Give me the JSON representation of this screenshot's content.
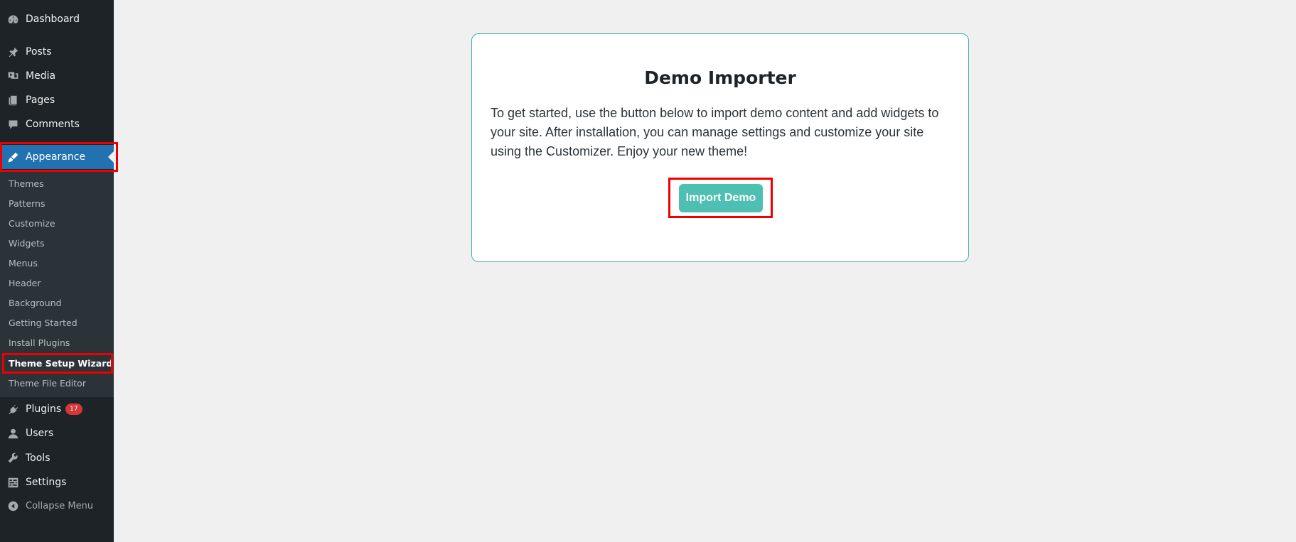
{
  "sidebar": {
    "items": [
      {
        "label": "Dashboard",
        "icon": "dashboard-icon"
      },
      {
        "label": "Posts",
        "icon": "pin-icon"
      },
      {
        "label": "Media",
        "icon": "media-icon"
      },
      {
        "label": "Pages",
        "icon": "pages-icon"
      },
      {
        "label": "Comments",
        "icon": "comment-icon"
      },
      {
        "label": "Appearance",
        "icon": "brush-icon"
      },
      {
        "label": "Plugins",
        "icon": "plugin-icon",
        "badge": "17"
      },
      {
        "label": "Users",
        "icon": "user-icon"
      },
      {
        "label": "Tools",
        "icon": "wrench-icon"
      },
      {
        "label": "Settings",
        "icon": "settings-icon"
      }
    ],
    "submenu": [
      "Themes",
      "Patterns",
      "Customize",
      "Widgets",
      "Menus",
      "Header",
      "Background",
      "Getting Started",
      "Install Plugins",
      "Theme Setup Wizard",
      "Theme File Editor"
    ],
    "collapse_label": "Collapse Menu"
  },
  "card": {
    "title": "Demo Importer",
    "description": "To get started, use the button below to import demo content and add widgets to your site. After installation, you can manage settings and customize your site using the Customizer. Enjoy your new theme!",
    "button_label": "Import Demo"
  },
  "colors": {
    "sidebar_bg": "#1d2327",
    "submenu_bg": "#2c3338",
    "accent": "#2271b1",
    "button": "#4dbfb3",
    "badge": "#d63638",
    "highlight": "#ee0000"
  }
}
